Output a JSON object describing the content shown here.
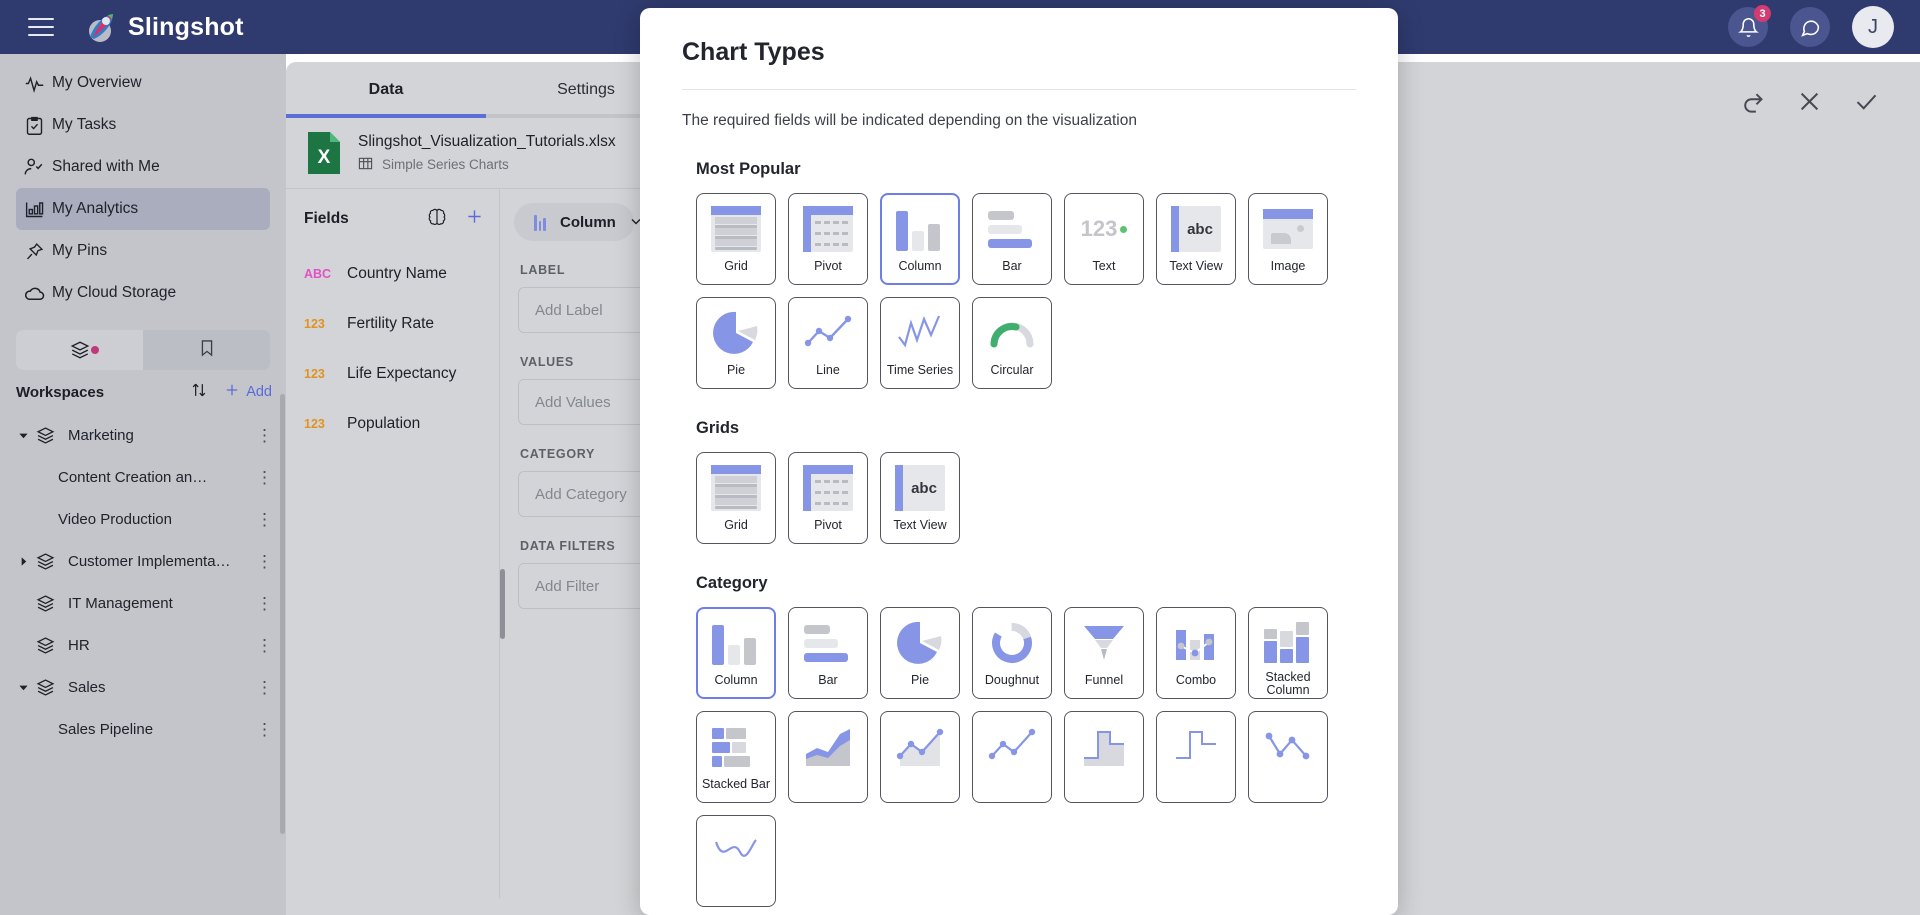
{
  "topbar": {
    "brand": "Slingshot",
    "menu_icon": "hamburger-icon",
    "notifications_badge": "3",
    "avatar_initial": "J"
  },
  "sidebar": {
    "nav": [
      {
        "label": "My Overview",
        "icon": "activity-icon",
        "active": false
      },
      {
        "label": "My Tasks",
        "icon": "clipboard-check-icon",
        "active": false
      },
      {
        "label": "Shared with Me",
        "icon": "user-check-icon",
        "active": false
      },
      {
        "label": "My Analytics",
        "icon": "bar-chart-icon",
        "active": true
      },
      {
        "label": "My Pins",
        "icon": "pin-icon",
        "active": false
      },
      {
        "label": "My Cloud Storage",
        "icon": "cloud-icon",
        "active": false
      }
    ],
    "segments": [
      {
        "icon": "layers-icon",
        "selected": true,
        "dot": true
      },
      {
        "icon": "bookmark-icon",
        "selected": false,
        "dot": false
      }
    ],
    "workspaces_title": "Workspaces",
    "sort_icon": "sort-arrows-icon",
    "add_label": "Add",
    "add_icon": "plus-icon",
    "tree": [
      {
        "label": "Marketing",
        "level": 0,
        "caret": "down",
        "icon": "layers-icon",
        "menu": true
      },
      {
        "label": "Content Creation an…",
        "level": 1,
        "caret": "none",
        "icon": "",
        "menu": true
      },
      {
        "label": "Video Production",
        "level": 1,
        "caret": "none",
        "icon": "",
        "menu": true
      },
      {
        "label": "Customer Implementa…",
        "level": 0,
        "caret": "right",
        "icon": "layers-icon",
        "menu": true
      },
      {
        "label": "IT Management",
        "level": 0,
        "caret": "none",
        "icon": "layers-icon",
        "menu": true
      },
      {
        "label": "HR",
        "level": 0,
        "caret": "none",
        "icon": "layers-icon",
        "menu": true
      },
      {
        "label": "Sales",
        "level": 0,
        "caret": "down",
        "icon": "layers-icon",
        "menu": true
      },
      {
        "label": "Sales Pipeline",
        "level": 1,
        "caret": "none",
        "icon": "",
        "menu": true
      }
    ]
  },
  "center": {
    "tabs": [
      {
        "label": "Data",
        "active": true
      },
      {
        "label": "Settings",
        "active": false
      }
    ],
    "file": {
      "name": "Slingshot_Visualization_Tutorials.xlsx",
      "sheet": "Simple Series Charts",
      "file_icon": "excel-icon",
      "sheet_icon": "table-icon"
    },
    "fields": {
      "title": "Fields",
      "ai_icon": "brain-icon",
      "add_icon": "plus-icon",
      "items": [
        {
          "type": "ABC",
          "name": "Country Name"
        },
        {
          "type": "123",
          "name": "Fertility Rate"
        },
        {
          "type": "123",
          "name": "Life Expectancy"
        },
        {
          "type": "123",
          "name": "Population"
        }
      ]
    },
    "chart_selector": {
      "label": "Column",
      "caret_icon": "chevron-down-icon"
    },
    "zones": [
      {
        "title": "LABEL",
        "placeholder": "Add Label"
      },
      {
        "title": "VALUES",
        "placeholder": "Add Values"
      },
      {
        "title": "CATEGORY",
        "placeholder": "Add Category"
      },
      {
        "title": "DATA FILTERS",
        "placeholder": "Add Filter"
      }
    ]
  },
  "toolbar": {
    "actions": [
      {
        "icon": "redo-icon",
        "name": "redo-button"
      },
      {
        "icon": "close-icon",
        "name": "cancel-button"
      },
      {
        "icon": "check-icon",
        "name": "confirm-button"
      }
    ]
  },
  "modal": {
    "title": "Chart Types",
    "subtitle": "The required fields will be indicated depending on the visualization",
    "sections": [
      {
        "title": "Most Popular",
        "tiles": [
          {
            "label": "Grid",
            "art": "grid",
            "selected": false
          },
          {
            "label": "Pivot",
            "art": "pivot",
            "selected": false
          },
          {
            "label": "Column",
            "art": "column",
            "selected": true
          },
          {
            "label": "Bar",
            "art": "bar",
            "selected": false
          },
          {
            "label": "Text",
            "art": "text",
            "selected": false
          },
          {
            "label": "Text View",
            "art": "textview",
            "selected": false
          },
          {
            "label": "Image",
            "art": "image",
            "selected": false
          },
          {
            "label": "Pie",
            "art": "pie",
            "selected": false
          },
          {
            "label": "Line",
            "art": "line",
            "selected": false
          },
          {
            "label": "Time Series",
            "art": "timeseries",
            "selected": false
          },
          {
            "label": "Circular",
            "art": "circular",
            "selected": false
          }
        ]
      },
      {
        "title": "Grids",
        "tiles": [
          {
            "label": "Grid",
            "art": "grid",
            "selected": false
          },
          {
            "label": "Pivot",
            "art": "pivot",
            "selected": false
          },
          {
            "label": "Text View",
            "art": "textview",
            "selected": false
          }
        ]
      },
      {
        "title": "Category",
        "tiles": [
          {
            "label": "Column",
            "art": "column",
            "selected": true
          },
          {
            "label": "Bar",
            "art": "bar",
            "selected": false
          },
          {
            "label": "Pie",
            "art": "pie",
            "selected": false
          },
          {
            "label": "Doughnut",
            "art": "doughnut",
            "selected": false
          },
          {
            "label": "Funnel",
            "art": "funnel",
            "selected": false
          },
          {
            "label": "Combo",
            "art": "combo",
            "selected": false
          },
          {
            "label": "Stacked Column",
            "art": "stackedcol",
            "selected": false
          },
          {
            "label": "Stacked Bar",
            "art": "stackedbar",
            "selected": false
          },
          {
            "label": "",
            "art": "area",
            "selected": false
          },
          {
            "label": "",
            "art": "linemarker",
            "selected": false
          },
          {
            "label": "",
            "art": "scatterline",
            "selected": false
          },
          {
            "label": "",
            "art": "stepfilled",
            "selected": false
          },
          {
            "label": "",
            "art": "step",
            "selected": false
          },
          {
            "label": "",
            "art": "pointline",
            "selected": false
          },
          {
            "label": "",
            "art": "smoothline",
            "selected": false
          }
        ]
      }
    ]
  },
  "colors": {
    "navy": "#2f3a6e",
    "accent_blue": "#6d7fe4",
    "tile_blue": "#8795e6",
    "pink_dot": "#d43b6e",
    "green_dot": "#5cc271",
    "sidebar_bg": "#c3c5cb",
    "panel_bg": "#d3d4d7"
  }
}
